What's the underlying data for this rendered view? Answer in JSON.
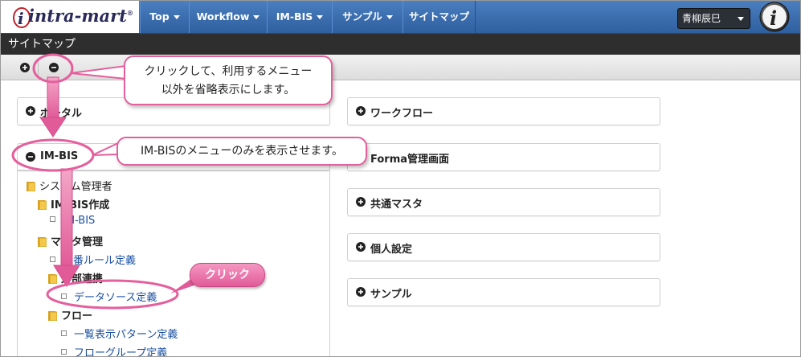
{
  "nav": {
    "logo_text": "intra-mart",
    "items": [
      {
        "label": "Top",
        "dropdown": true
      },
      {
        "label": "Workflow",
        "dropdown": true
      },
      {
        "label": "IM-BIS",
        "dropdown": true
      },
      {
        "label": "サンプル",
        "dropdown": true
      },
      {
        "label": "サイトマップ",
        "dropdown": false
      }
    ],
    "user_name": "青柳辰巳"
  },
  "page": {
    "title": "サイトマップ"
  },
  "panels": {
    "portal": "ポータル",
    "imbis": "IM-BIS",
    "workflow": "ワークフロー",
    "forma": "Forma管理画面",
    "common_master": "共通マスタ",
    "personal": "個人設定",
    "sample": "サンプル"
  },
  "tree": {
    "system_admin": "システム管理者",
    "imbis_create": "IM-BIS作成",
    "imbis_link": "IM-BIS",
    "master_mgmt": "マスタ管理",
    "numbering": "採番ルール定義",
    "external": "外部連携",
    "datasource": "データソース定義",
    "flow": "フロー",
    "list_pattern": "一覧表示パターン定義",
    "flow_group": "フローグループ定義"
  },
  "annotations": {
    "collapse_line1": "クリックして、利用するメニュー",
    "collapse_line2": "以外を省略表示にします。",
    "imbis_only": "IM-BISのメニューのみを表示させます。",
    "click": "クリック"
  },
  "colors": {
    "accent": "#e4609d",
    "nav": "#3a6cad",
    "link": "#1a4fa0"
  }
}
